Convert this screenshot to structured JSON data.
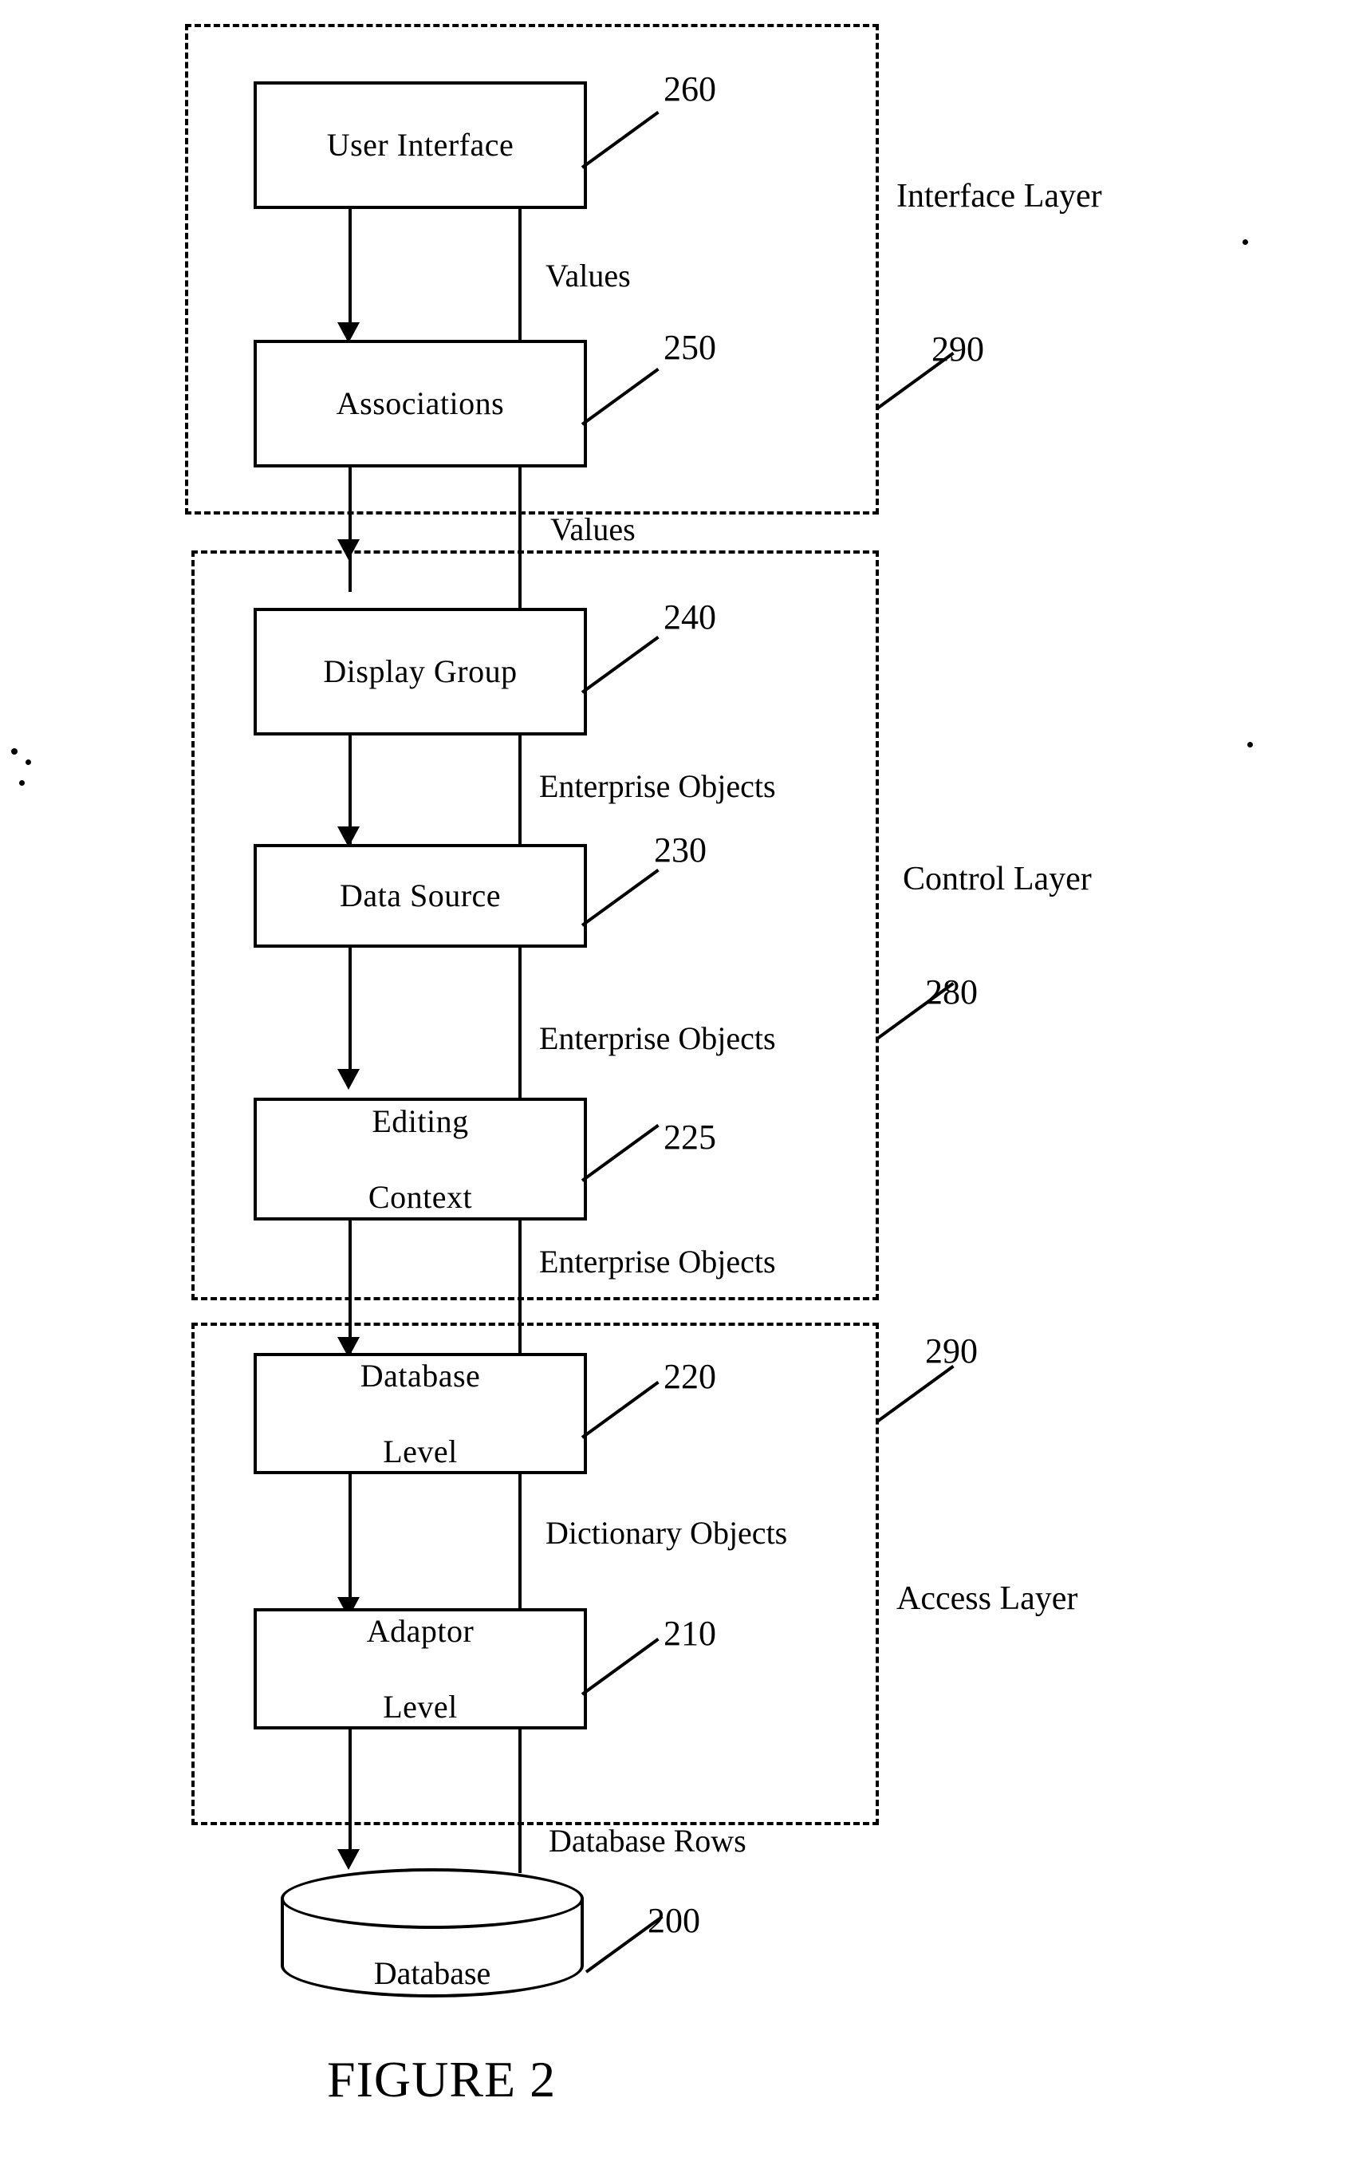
{
  "figure": {
    "caption": "FIGURE 2"
  },
  "boxes": [
    {
      "id": "user-interface",
      "label": "User Interface",
      "ref": "260"
    },
    {
      "id": "associations",
      "label": "Associations",
      "ref": "250"
    },
    {
      "id": "display-group",
      "label": "Display Group",
      "ref": "240"
    },
    {
      "id": "data-source",
      "label": "Data Source",
      "ref": "230"
    },
    {
      "id": "editing-context",
      "label_line1": "Editing",
      "label_line2": "Context",
      "ref": "225"
    },
    {
      "id": "database-level",
      "label_line1": "Database",
      "label_line2": "Level",
      "ref": "220"
    },
    {
      "id": "adaptor-level",
      "label_line1": "Adaptor",
      "label_line2": "Level",
      "ref": "210"
    }
  ],
  "datastore": {
    "label": "Database",
    "ref": "200"
  },
  "flow_labels": [
    {
      "id": "ui-assoc",
      "text": "Values"
    },
    {
      "id": "assoc-dg",
      "text": "Values"
    },
    {
      "id": "dg-ds",
      "text": "Enterprise Objects"
    },
    {
      "id": "ds-ec",
      "text": "Enterprise Objects"
    },
    {
      "id": "ec-dbl",
      "text": "Enterprise Objects"
    },
    {
      "id": "dbl-adaptor",
      "text": "Dictionary Objects"
    },
    {
      "id": "adaptor-db",
      "text": "Database Rows"
    }
  ],
  "layers": [
    {
      "id": "interface-layer",
      "name": "Interface Layer",
      "ref": "290"
    },
    {
      "id": "control-layer",
      "name": "Control Layer",
      "ref": "280"
    },
    {
      "id": "access-layer",
      "name": "Access Layer",
      "ref": "290"
    }
  ]
}
